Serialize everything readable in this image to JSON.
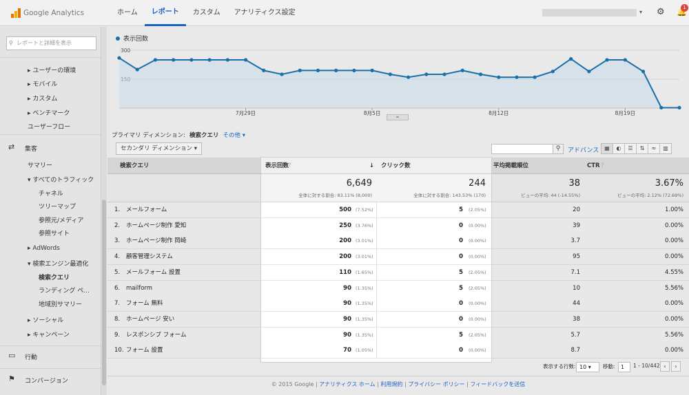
{
  "topbar": {
    "logo_text": "Google Analytics",
    "nav": [
      "ホーム",
      "レポート",
      "カスタム",
      "アナリティクス設定"
    ],
    "active_nav": "レポート",
    "notification_count": "1"
  },
  "sidebar": {
    "search_placeholder": "レポートと詳細を表示",
    "items": [
      {
        "label": "ユーザーの環境",
        "prefix": "▸"
      },
      {
        "label": "モバイル",
        "prefix": "▸"
      },
      {
        "label": "カスタム",
        "prefix": "▸"
      },
      {
        "label": "ベンチマーク",
        "prefix": "▸"
      },
      {
        "label": "ユーザーフロー",
        "prefix": ""
      }
    ],
    "section_acquisition": "集客",
    "acq_items": [
      {
        "label": "サマリー",
        "prefix": ""
      },
      {
        "label": "すべてのトラフィック",
        "prefix": "▾"
      },
      {
        "label": "チャネル",
        "prefix": ""
      },
      {
        "label": "ツリーマップ",
        "prefix": ""
      },
      {
        "label": "参照元/メディア",
        "prefix": ""
      },
      {
        "label": "参照サイト",
        "prefix": ""
      },
      {
        "label": "AdWords",
        "prefix": "▸"
      },
      {
        "label": "検索エンジン最適化",
        "prefix": "▾"
      },
      {
        "label": "検索クエリ",
        "prefix": ""
      },
      {
        "label": "ランディング ペ...",
        "prefix": ""
      },
      {
        "label": "地域別サマリー",
        "prefix": ""
      },
      {
        "label": "ソーシャル",
        "prefix": "▸"
      },
      {
        "label": "キャンペーン",
        "prefix": "▸"
      }
    ],
    "section_behavior": "行動",
    "section_conversion": "コンバージョン"
  },
  "chart": {
    "legend": "表示回数",
    "ytick_top": "300",
    "ytick_mid": "150",
    "xticks": [
      "7月29日",
      "8月5日",
      "8月12日",
      "8月19日"
    ]
  },
  "chart_data": {
    "type": "line",
    "series": [
      {
        "name": "表示回数",
        "values": [
          260,
          200,
          250,
          250,
          250,
          250,
          250,
          250,
          195,
          175,
          195,
          195,
          195,
          195,
          195,
          175,
          160,
          175,
          175,
          195,
          175,
          160,
          160,
          160,
          190,
          255,
          190,
          250,
          250,
          190,
          2,
          2
        ]
      }
    ],
    "ylim": [
      0,
      300
    ],
    "xticks": [
      "7月29日",
      "8月5日",
      "8月12日",
      "8月19日"
    ],
    "color": "#1a6fa8"
  },
  "controls": {
    "primary_dim_label": "プライマリ ディメンション:",
    "primary_dim_value": "検索クエリ",
    "other_label": "その他 ▾",
    "secondary_dim": "セカンダリ ディメンション ▾",
    "advanced": "アドバンス"
  },
  "table": {
    "headers": {
      "query": "検索クエリ",
      "impressions": "表示回数",
      "clicks": "クリック数",
      "avg_position": "平均掲載順位",
      "ctr": "CTR"
    },
    "summary": {
      "impressions": "6,649",
      "impressions_sub": "全体に対する割合: 83.11% (8,000)",
      "clicks": "244",
      "clicks_sub": "全体に対する割合: 143.53% (170)",
      "avg_position": "38",
      "avg_position_sub": "ビューの平均: 44 (-14.55%)",
      "ctr": "3.67%",
      "ctr_sub": "ビューの平均: 2.12% (72.69%)"
    },
    "rows": [
      {
        "n": "1.",
        "q": "メールフォーム",
        "imp": "500",
        "imp_pct": "(7.52%)",
        "clk": "5",
        "clk_pct": "(2.05%)",
        "pos": "20",
        "ctr": "1.00%"
      },
      {
        "n": "2.",
        "q": "ホームページ制作 愛知",
        "imp": "250",
        "imp_pct": "(3.76%)",
        "clk": "0",
        "clk_pct": "(0.00%)",
        "pos": "39",
        "ctr": "0.00%"
      },
      {
        "n": "3.",
        "q": "ホームページ制作 岡崎",
        "imp": "200",
        "imp_pct": "(3.01%)",
        "clk": "0",
        "clk_pct": "(0.00%)",
        "pos": "3.7",
        "ctr": "0.00%"
      },
      {
        "n": "4.",
        "q": "顧客管理システム",
        "imp": "200",
        "imp_pct": "(3.01%)",
        "clk": "0",
        "clk_pct": "(0.00%)",
        "pos": "95",
        "ctr": "0.00%"
      },
      {
        "n": "5.",
        "q": "メールフォーム 設置",
        "imp": "110",
        "imp_pct": "(1.65%)",
        "clk": "5",
        "clk_pct": "(2.05%)",
        "pos": "7.1",
        "ctr": "4.55%"
      },
      {
        "n": "6.",
        "q": "mailform",
        "imp": "90",
        "imp_pct": "(1.35%)",
        "clk": "5",
        "clk_pct": "(2.05%)",
        "pos": "10",
        "ctr": "5.56%"
      },
      {
        "n": "7.",
        "q": "フォーム 無料",
        "imp": "90",
        "imp_pct": "(1.35%)",
        "clk": "0",
        "clk_pct": "(0.00%)",
        "pos": "44",
        "ctr": "0.00%"
      },
      {
        "n": "8.",
        "q": "ホームページ 安い",
        "imp": "90",
        "imp_pct": "(1.35%)",
        "clk": "0",
        "clk_pct": "(0.00%)",
        "pos": "38",
        "ctr": "0.00%"
      },
      {
        "n": "9.",
        "q": "レスポンシブ フォーム",
        "imp": "90",
        "imp_pct": "(1.35%)",
        "clk": "5",
        "clk_pct": "(2.05%)",
        "pos": "5.7",
        "ctr": "5.56%"
      },
      {
        "n": "10.",
        "q": "フォーム 設置",
        "imp": "70",
        "imp_pct": "(1.05%)",
        "clk": "0",
        "clk_pct": "(0.00%)",
        "pos": "8.7",
        "ctr": "0.00%"
      }
    ]
  },
  "pagination": {
    "rows_label": "表示する行数:",
    "rows_value": "10 ▾",
    "goto_label": "移動:",
    "goto_value": "1",
    "range": "1 - 10/442",
    "prev": "‹",
    "next": "›"
  },
  "footer": {
    "copyright": "© 2015 Google",
    "links": [
      "アナリティクス ホーム",
      "利用規約",
      "プライバシー ポリシー",
      "フィードバックを送信"
    ]
  }
}
